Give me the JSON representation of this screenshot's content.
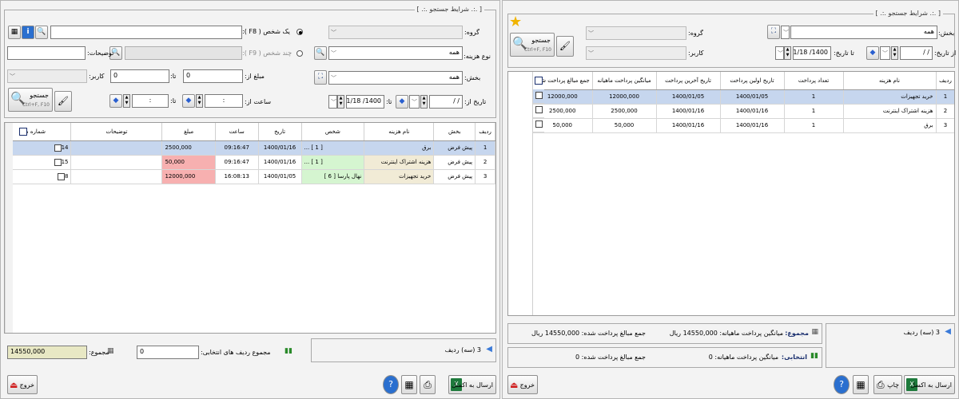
{
  "left": {
    "search_title": "[ .:. شرایط جستجو .:. ]",
    "group_label": "گروه:",
    "group_value": "",
    "one_person_label": "یک شخص ( F8 ):",
    "multi_person_label": "چند شخص ( F9 ):",
    "expense_type_label": "نوع هزینه:",
    "expense_type_value": "همه",
    "description_label": "توضیحات:",
    "section_label": "بخش:",
    "section_value": "همه",
    "amount_from_label": "مبلغ از:",
    "amount_from_value": "0",
    "amount_to_label": "تا:",
    "amount_to_value": "0",
    "cashier_label": "کاربر:",
    "date_from_label": "تاریخ از:",
    "date_from_value": "/ /",
    "date_to_label": "تا:",
    "date_to_value": "1400/ 1/18",
    "time_from_label": "ساعت از:",
    "time_from_value": ":",
    "time_to_label": "تا:",
    "time_to_value": ":",
    "search_button": "جستجو",
    "search_shortcut": "Ctrl+F, F10",
    "columns": [
      "ردیف",
      "بخش",
      "نام هزینه",
      "شخص",
      "تاریخ",
      "ساعت",
      "مبلغ",
      "توضیحات",
      "شماره سند"
    ],
    "rows": [
      {
        "idx": "1",
        "section": "پیش فرض",
        "name": "برق",
        "person": "[ 1 ] ...",
        "date": "1400/01/16",
        "time": "09:16:47",
        "amount": "2500,000",
        "desc": "",
        "doc": "14"
      },
      {
        "idx": "2",
        "section": "پیش فرض",
        "name": "هزینه اشتراک اینترنت",
        "person": "[ 1 ] ...",
        "date": "1400/01/16",
        "time": "09:16:47",
        "amount": "50,000",
        "desc": "",
        "doc": "15"
      },
      {
        "idx": "3",
        "section": "پیش فرض",
        "name": "خرید تجهیزات",
        "person": "نهال پارسا [ 6 ]",
        "date": "1400/01/05",
        "time": "16:08:13",
        "amount": "12000,000",
        "desc": "",
        "doc": "8"
      }
    ],
    "row_count": "3 (سه) ردیف",
    "selected_sum_label": "مجموع ردیف های انتخابی:",
    "selected_sum_value": "0",
    "total_label": "مجموع:",
    "total_value": "14550,000",
    "export_excel": "ارسال به اکسل",
    "exit": "خروج"
  },
  "right": {
    "search_title": "[ .:. شرایط جستجو .:. ]",
    "section_label": "بخش:",
    "section_value": "همه",
    "group_label": "گروه:",
    "group_value": "",
    "cashier_label": "کاربر:",
    "cashier_value": "",
    "date_from_label": "از تاریخ:",
    "date_from_value": "/ /",
    "date_to_label": "تا تاریخ:",
    "date_to_value": "1400/ 1/18",
    "search_button": "جستجو",
    "search_shortcut": "Ctrl+F, F10",
    "columns": [
      "ردیف",
      "نام هزینه",
      "تعداد پرداخت",
      "تاریخ اولین پرداخت",
      "تاریخ آخرین پرداخت",
      "میانگین پرداخت ماهیانه",
      "جمع مبالغ پرداخت شده"
    ],
    "rows": [
      {
        "idx": "1",
        "name": "خرید تجهیزات",
        "count": "1",
        "first": "1400/01/05",
        "last": "1400/01/05",
        "avg": "12000,000",
        "sum": "12000,000"
      },
      {
        "idx": "2",
        "name": "هزینه اشتراک اینترنت",
        "count": "1",
        "first": "1400/01/16",
        "last": "1400/01/16",
        "avg": "2500,000",
        "sum": "2500,000"
      },
      {
        "idx": "3",
        "name": "برق",
        "count": "1",
        "first": "1400/01/16",
        "last": "1400/01/16",
        "avg": "50,000",
        "sum": "50,000"
      }
    ],
    "row_count": "3 (سه) ردیف",
    "total_label": "مجموع:",
    "total_avg": "میانگین پرداخت ماهیانه: 14550,000 ریال",
    "total_sum": "جمع مبالغ پرداخت شده: 14550,000 ریال",
    "selected_label": "انتخابی:",
    "selected_avg": "میانگین پرداخت ماهیانه: 0",
    "selected_sum": "جمع مبالغ پرداخت شده: 0",
    "export_excel": "ارسال به اکسل",
    "print": "چاپ",
    "exit": "خروج"
  }
}
